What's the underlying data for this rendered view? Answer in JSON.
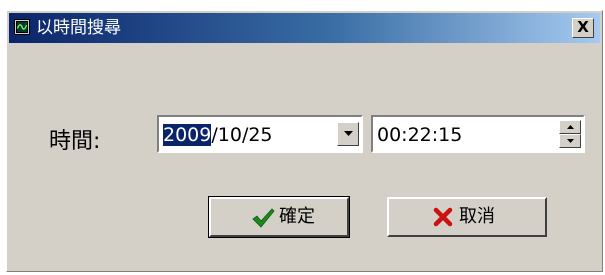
{
  "window": {
    "title": "以時間搜尋",
    "close_label": "X",
    "title_gradient_start": "#0a246a",
    "title_gradient_end": "#a6caf0"
  },
  "form": {
    "time_label": "時間:",
    "date_year_selected": "2009",
    "date_rest": "/10/25",
    "time_value": "00:22:15"
  },
  "buttons": {
    "ok_label": "確定",
    "cancel_label": "取消",
    "ok_icon": "check-icon",
    "ok_icon_color": "#1e8a1e",
    "cancel_icon": "x-mark-icon",
    "cancel_icon_color": "#cc1111"
  }
}
